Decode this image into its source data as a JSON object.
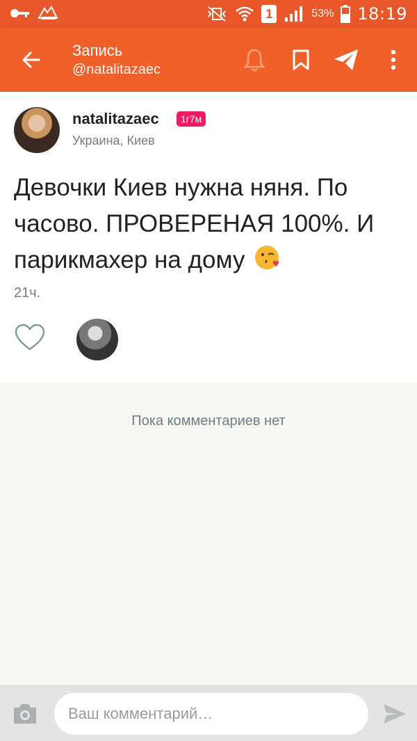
{
  "statusbar": {
    "battery_percent": "53%",
    "time": "18:19",
    "sim_number": "1",
    "icons": [
      "key-icon",
      "sms-icon",
      "vibrate-icon",
      "wifi-icon",
      "signal-icon",
      "battery-icon"
    ]
  },
  "appbar": {
    "title": "Запись",
    "subtitle": "@natalitazaec",
    "icons": [
      "back-arrow-icon",
      "bell-icon",
      "bookmark-icon",
      "send-icon",
      "more-vertical-icon"
    ],
    "accent_color": "#f0602b"
  },
  "post": {
    "username": "natalitazaec",
    "badge": "1г7м",
    "location": "Украина, Киев",
    "text": "Девочки Киев нужна няня. По часово. ПРОВЕРЕНАЯ 100%. И парикмахер на дому",
    "emoji": "kissing-face-heart-emoji",
    "time_ago": "21ч."
  },
  "comments": {
    "empty_text": "Пока комментариев нет"
  },
  "composer": {
    "placeholder": "Ваш комментарий…",
    "value": ""
  }
}
